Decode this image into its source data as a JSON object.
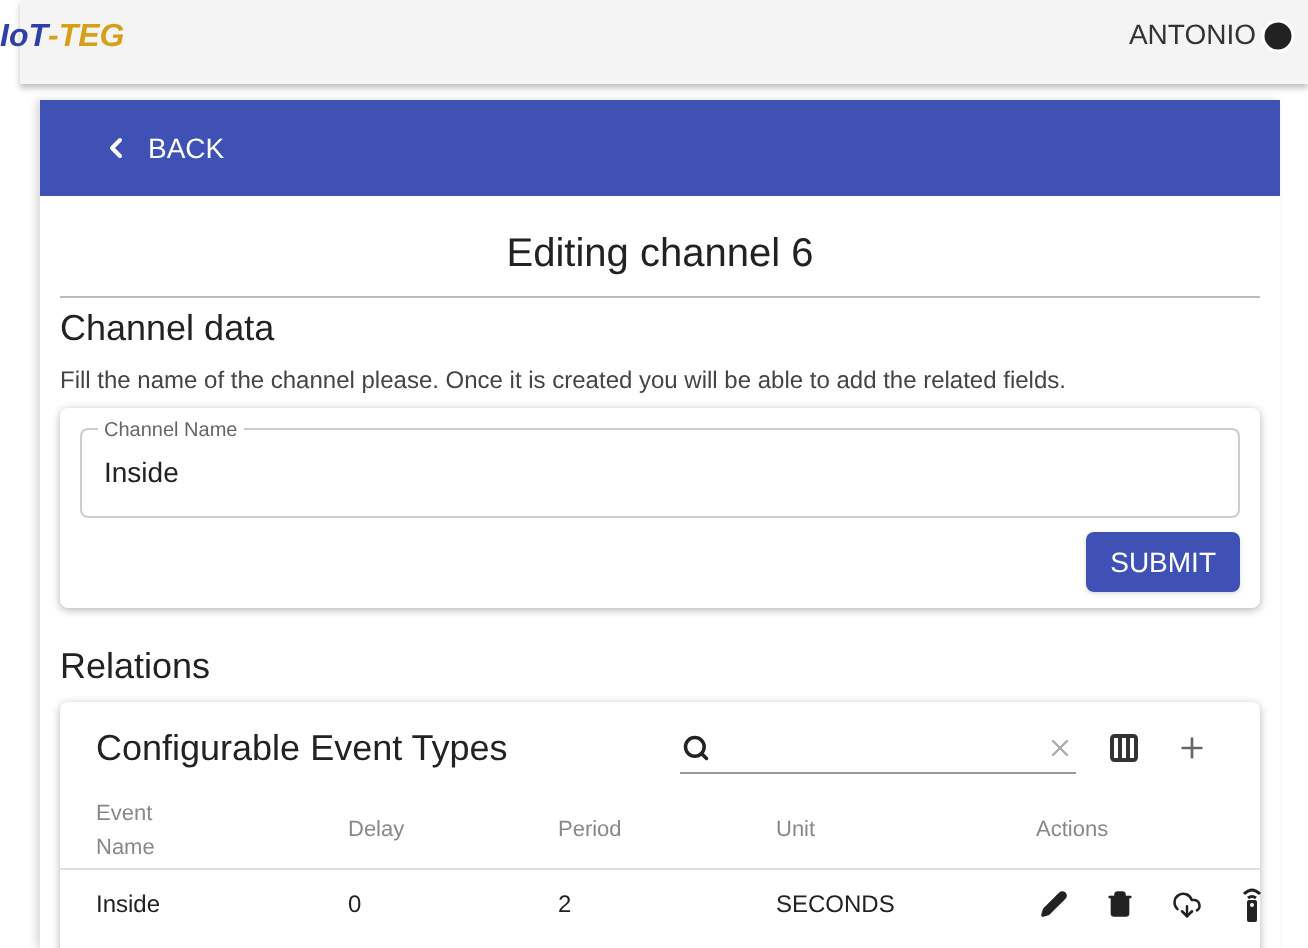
{
  "header": {
    "logo": [
      {
        "text": "IoT",
        "color": "#2f3fa8"
      },
      {
        "text": "-TEG",
        "color": "#d4a017"
      }
    ],
    "user": "ANTONIO"
  },
  "back_bar": {
    "label": "BACK"
  },
  "title": "Editing channel 6",
  "channel_data": {
    "heading": "Channel data",
    "description": "Fill the name of the channel please. Once it is created you will be able to add the related fields.",
    "field": {
      "label": "Channel Name",
      "value": "Inside"
    },
    "submit": "SUBMIT"
  },
  "relations": {
    "heading": "Relations",
    "table": {
      "title": "Configurable Event Types",
      "columns": [
        "Event Name",
        "Delay",
        "Period",
        "Unit",
        "Actions"
      ],
      "rows": [
        {
          "cells": [
            "Inside",
            "0",
            "2",
            "SECONDS"
          ]
        }
      ]
    }
  }
}
